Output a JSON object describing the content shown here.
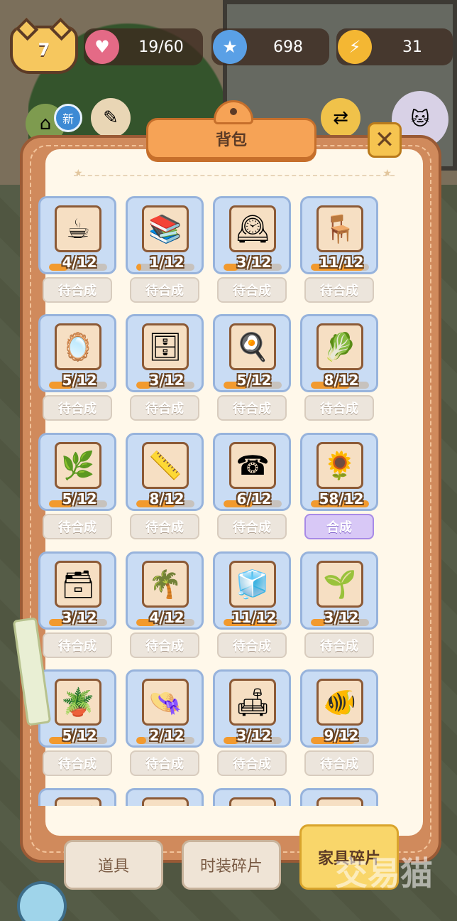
{
  "hud": {
    "level": "7",
    "hearts": {
      "icon": "heart-icon",
      "value": "19/60"
    },
    "stars": {
      "icon": "star-plus-icon",
      "value": "698"
    },
    "energy": {
      "icon": "lightning-plus-icon",
      "value": "31"
    }
  },
  "side_icons": {
    "new_badge": "新"
  },
  "panel": {
    "title": "背包",
    "close_label": "✕"
  },
  "items": [
    {
      "icon": "coffee-table-icon",
      "glyph": "☕",
      "count": "4/12",
      "progress": 0.333,
      "action": "待合成",
      "ready": false
    },
    {
      "icon": "bookcase-icon",
      "glyph": "📚",
      "count": "1/12",
      "progress": 0.083,
      "action": "待合成",
      "ready": false
    },
    {
      "icon": "cuckoo-clock-icon",
      "glyph": "🕰",
      "count": "3/12",
      "progress": 0.25,
      "action": "待合成",
      "ready": false
    },
    {
      "icon": "side-table-icon",
      "glyph": "🪑",
      "count": "11/12",
      "progress": 0.917,
      "action": "待合成",
      "ready": false
    },
    {
      "icon": "arched-mirror-icon",
      "glyph": "🪞",
      "count": "5/12",
      "progress": 0.417,
      "action": "待合成",
      "ready": false
    },
    {
      "icon": "wall-shelf-icon",
      "glyph": "🗄",
      "count": "3/12",
      "progress": 0.25,
      "action": "待合成",
      "ready": false
    },
    {
      "icon": "stove-icon",
      "glyph": "🍳",
      "count": "5/12",
      "progress": 0.417,
      "action": "待合成",
      "ready": false
    },
    {
      "icon": "cutting-board-icon",
      "glyph": "🥬",
      "count": "8/12",
      "progress": 0.667,
      "action": "待合成",
      "ready": false
    },
    {
      "icon": "hanging-plant-icon",
      "glyph": "🌿",
      "count": "5/12",
      "progress": 0.417,
      "action": "待合成",
      "ready": false
    },
    {
      "icon": "wooden-shelf-icon",
      "glyph": "📏",
      "count": "8/12",
      "progress": 0.667,
      "action": "待合成",
      "ready": false
    },
    {
      "icon": "wall-phone-icon",
      "glyph": "☎",
      "count": "6/12",
      "progress": 0.5,
      "action": "待合成",
      "ready": false
    },
    {
      "icon": "flower-pot-icon",
      "glyph": "🌻",
      "count": "58/12",
      "progress": 1.0,
      "action": "合成",
      "ready": true
    },
    {
      "icon": "cabinet-icon",
      "glyph": "🗃",
      "count": "3/12",
      "progress": 0.25,
      "action": "待合成",
      "ready": false
    },
    {
      "icon": "palm-plant-icon",
      "glyph": "🌴",
      "count": "4/12",
      "progress": 0.333,
      "action": "待合成",
      "ready": false
    },
    {
      "icon": "refrigerator-icon",
      "glyph": "🧊",
      "count": "11/12",
      "progress": 0.917,
      "action": "待合成",
      "ready": false
    },
    {
      "icon": "trellis-icon",
      "glyph": "🌱",
      "count": "3/12",
      "progress": 0.25,
      "action": "待合成",
      "ready": false
    },
    {
      "icon": "potted-plant-icon",
      "glyph": "🪴",
      "count": "5/12",
      "progress": 0.417,
      "action": "待合成",
      "ready": false
    },
    {
      "icon": "coat-rack-icon",
      "glyph": "👒",
      "count": "2/12",
      "progress": 0.167,
      "action": "待合成",
      "ready": false
    },
    {
      "icon": "sofa-icon",
      "glyph": "🛋",
      "count": "3/12",
      "progress": 0.25,
      "action": "待合成",
      "ready": false
    },
    {
      "icon": "fishbowl-table-icon",
      "glyph": "🐠",
      "count": "9/12",
      "progress": 0.75,
      "action": "待合成",
      "ready": false
    },
    {
      "icon": "partial-item-icon",
      "glyph": "🌿",
      "count": "",
      "progress": 0,
      "action": "",
      "ready": false
    },
    {
      "icon": "partial-item-icon",
      "glyph": "🪵",
      "count": "",
      "progress": 0,
      "action": "",
      "ready": false
    },
    {
      "icon": "partial-item-icon",
      "glyph": "🟫",
      "count": "",
      "progress": 0,
      "action": "",
      "ready": false
    },
    {
      "icon": "partial-item-icon",
      "glyph": "🟩",
      "count": "",
      "progress": 0,
      "action": "",
      "ready": false
    }
  ],
  "tabs": [
    {
      "label": "道具",
      "active": false
    },
    {
      "label": "时装碎片",
      "active": false
    },
    {
      "label": "家具碎片",
      "active": true
    }
  ],
  "watermark": "交易猫",
  "colors": {
    "panel": "#d08a5c",
    "card": "#c9dcf4",
    "progress": "#f29a2e",
    "ready_button": "#d8c8f6",
    "active_tab": "#f9d66a"
  }
}
